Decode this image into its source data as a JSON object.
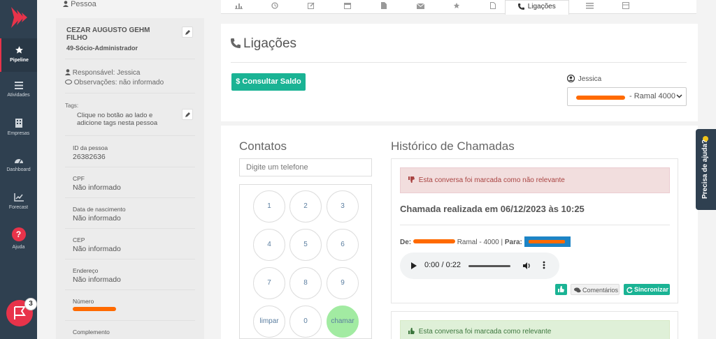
{
  "nav": {
    "items": [
      {
        "label": "Pipeline",
        "icon": "star-icon",
        "active": true
      },
      {
        "label": "Atividades",
        "icon": "list-icon"
      },
      {
        "label": "Empresas",
        "icon": "building-icon"
      },
      {
        "label": "Dashboard",
        "icon": "dashboard-icon"
      },
      {
        "label": "Forecast",
        "icon": "chart-line-icon"
      },
      {
        "label": "Ajuda",
        "icon": "question-icon",
        "glyph": "?"
      }
    ],
    "notification_count": "3"
  },
  "person": {
    "header": "Pessoa",
    "name": "CEZAR AUGUSTO GEHM FILHO",
    "role": "49-Sócio-Administrador",
    "responsavel": "Responsável: Jessica",
    "observacoes": "Observações: não informado",
    "tags_label": "Tags:",
    "tags_hint": "Clique no botão ao lado e adicione tags nesta pessoa",
    "fields": [
      {
        "label": "ID da pessoa",
        "value": "26382636"
      },
      {
        "label": "CPF",
        "value": "Não informado"
      },
      {
        "label": "Data de nascimento",
        "value": "Não informado"
      },
      {
        "label": "CEP",
        "value": "Não informado"
      },
      {
        "label": "Endereço",
        "value": "Não informado"
      },
      {
        "label": "Número",
        "value": ""
      },
      {
        "label": "Complemento",
        "value": ""
      }
    ]
  },
  "tabs": [
    {
      "icon": "bar-chart-icon"
    },
    {
      "icon": "history-icon"
    },
    {
      "icon": "edit-icon"
    },
    {
      "icon": "calendar-icon"
    },
    {
      "icon": "file-icon"
    },
    {
      "icon": "envelope-icon"
    },
    {
      "icon": "star-icon"
    },
    {
      "icon": "document-icon"
    },
    {
      "icon": "phone-icon",
      "label": "Ligações",
      "active": true
    },
    {
      "icon": "list-icon"
    },
    {
      "icon": "card-icon"
    }
  ],
  "main": {
    "title": "Ligações",
    "consult_button": "$ Consultar Saldo",
    "agent_name": "Jessica",
    "ramal_select": "- Ramal 4000"
  },
  "contatos": {
    "title": "Contatos",
    "phone_placeholder": "Digite um telefone",
    "keys": [
      "1",
      "2",
      "3",
      "4",
      "5",
      "6",
      "7",
      "8",
      "9",
      "limpar",
      "0",
      "chamar"
    ]
  },
  "historico": {
    "title": "Histórico de Chamadas",
    "calls": [
      {
        "alert": "Esta conversa foi marcada como não relevante",
        "title": "Chamada realizada em 06/12/2023 às 10:25",
        "de_label": "De:",
        "ramal_text": "Ramal - 4000 |",
        "para_label": "Para:",
        "audio_time": "0:00 / 0:22",
        "comments_label": "Comentários",
        "sync_label": "Sincronizar"
      },
      {
        "alert": "Esta conversa foi marcada como relevante"
      }
    ]
  },
  "help_tab": "Precisa de ajuda?"
}
